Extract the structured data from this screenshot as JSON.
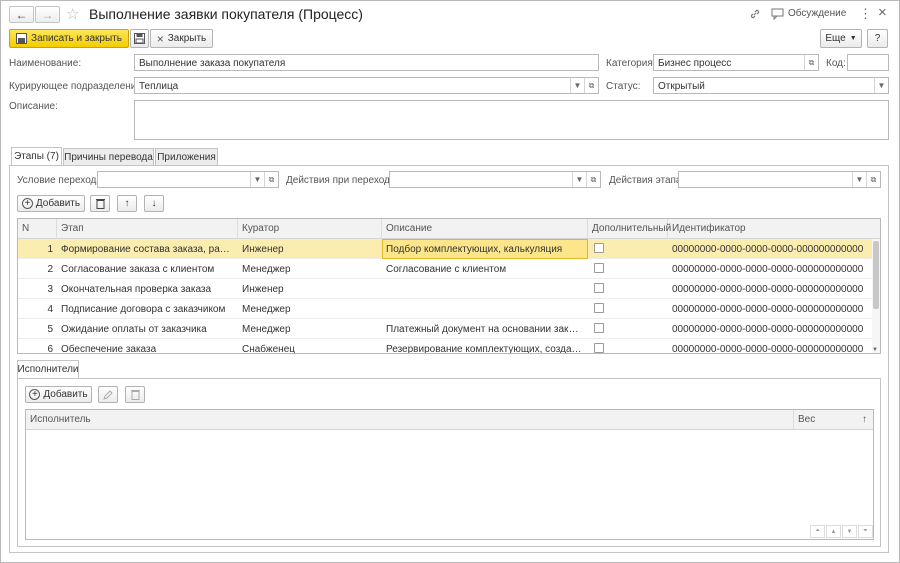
{
  "header": {
    "title": "Выполнение заявки покупателя (Процесс)",
    "discussion_label": "Обсуждение"
  },
  "toolbar": {
    "save_close_label": "Записать и закрыть",
    "close_label": "Закрыть",
    "more_label": "Еще",
    "help_label": "?"
  },
  "form": {
    "name_label": "Наименование:",
    "name_value": "Выполнение заказа покупателя",
    "category_label": "Категория:",
    "category_value": "Бизнес процесс",
    "code_label": "Код:",
    "code_value": "",
    "department_label": "Курирующее подразделение:",
    "department_value": "Теплица",
    "status_label": "Статус:",
    "status_value": "Открытый",
    "description_label": "Описание:",
    "description_value": ""
  },
  "tabs": [
    {
      "label": "Этапы (7)"
    },
    {
      "label": "Причины перевода"
    },
    {
      "label": "Приложения"
    }
  ],
  "stages": {
    "condition_label": "Условие перехода:",
    "actions_label": "Действия при переходе:",
    "stage_actions_label": "Действия этапа:",
    "add_label": "Добавить",
    "columns": [
      "N",
      "Этап",
      "Куратор",
      "Описание",
      "Дополнительный",
      "Идентификатор"
    ],
    "rows": [
      {
        "n": "1",
        "stage": "Формирование состава заказа, расчет…",
        "curator": "Инженер",
        "desc": "Подбор комплектующих, калькуляция",
        "id": "00000000-0000-0000-0000-000000000000"
      },
      {
        "n": "2",
        "stage": "Согласование заказа с клиентом",
        "curator": "Менеджер",
        "desc": "Согласование с клиентом",
        "id": "00000000-0000-0000-0000-000000000000"
      },
      {
        "n": "3",
        "stage": "Окончательная проверка заказа",
        "curator": "Инженер",
        "desc": "",
        "id": "00000000-0000-0000-0000-000000000000"
      },
      {
        "n": "4",
        "stage": "Подписание договора с заказчиком",
        "curator": "Менеджер",
        "desc": "",
        "id": "00000000-0000-0000-0000-000000000000"
      },
      {
        "n": "5",
        "stage": "Ожидание оплаты от заказчика",
        "curator": "Менеджер",
        "desc": "Платежный документ на основании заказа",
        "id": "00000000-0000-0000-0000-000000000000"
      },
      {
        "n": "6",
        "stage": "Обеспечение заказа",
        "curator": "Снабженец",
        "desc": "Резервирование комплектующих, создание …",
        "id": "00000000-0000-0000-0000-000000000000"
      }
    ]
  },
  "executors": {
    "tab_label": "Исполнители",
    "add_label": "Добавить",
    "col_executor": "Исполнитель",
    "col_weight": "Вес",
    "sort_glyph": "↑"
  },
  "icons": {
    "back": "←",
    "forward": "→",
    "star": "☆",
    "link": "🔗",
    "discussion": "💬",
    "menu": "⋮",
    "close": "×",
    "up": "↑",
    "down": "↓"
  }
}
